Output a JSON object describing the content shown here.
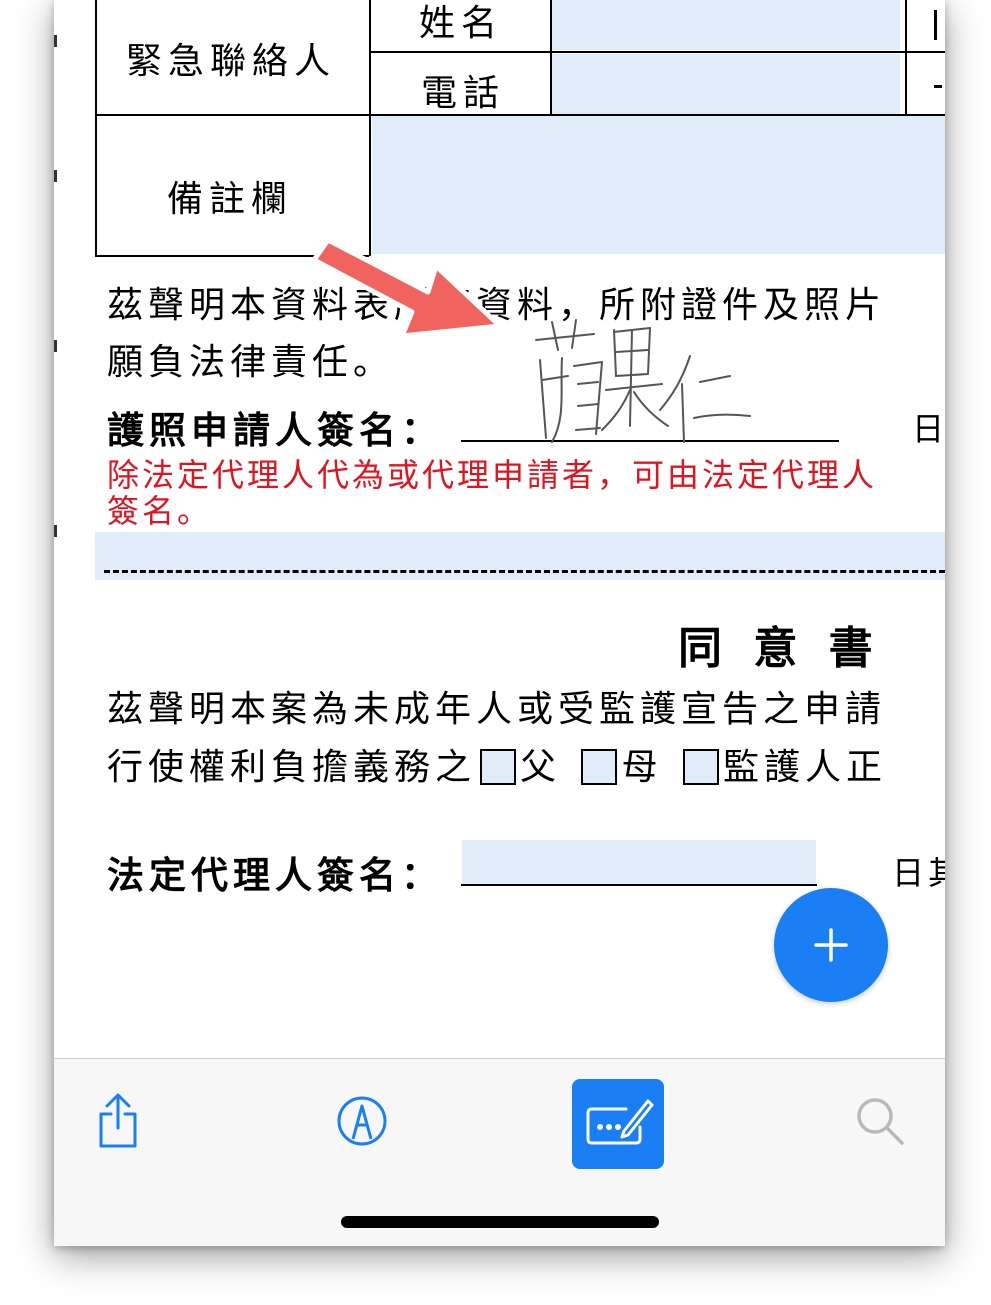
{
  "form": {
    "emergency_contact_label": "緊急聯絡人",
    "name_label": "姓名",
    "phone_label": "電話",
    "remarks_label": "備註欄",
    "declaration_line1": "茲聲明本資料表所填資料，所附證件及照片",
    "declaration_line2": "願負法律責任。",
    "applicant_signature_label": "護照申請人簽名：",
    "date_label": "日",
    "applicant_signature_value": "蘋果仁",
    "legal_rep_note_line1": "除法定代理人代為或代理申請者，可由法定代理人",
    "legal_rep_note_line2": "簽名。"
  },
  "consent": {
    "title": "同 意 書",
    "line1": "茲聲明本案為未成年人或受監護宣告之申請",
    "line2_prefix": "行使權利負擔義務之",
    "father_label": "父",
    "mother_label": "母",
    "guardian_label": "監護人正",
    "legal_rep_signature_label": "法定代理人簽名：",
    "date_label": "日其"
  },
  "colors": {
    "field_fill": "#e1ecfb",
    "accent_blue": "#1a7ff5",
    "annotation_arrow": "#f0635f",
    "warning_red": "#e0141e"
  },
  "toolbar": {
    "share": "share-icon",
    "markup": "markup-pen-icon",
    "fill_and_sign": "fill-and-sign-icon",
    "search": "search-icon"
  },
  "fab": {
    "icon": "plus-icon"
  }
}
